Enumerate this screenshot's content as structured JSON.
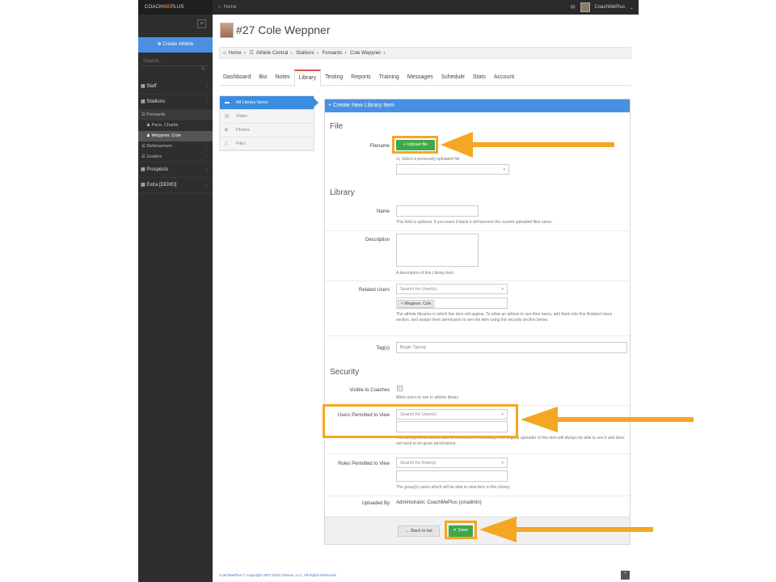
{
  "app": {
    "brand_pre": "COACH",
    "brand_me": "ME",
    "brand_post": "PLUS",
    "home": "Home",
    "user": "CoachMePlus",
    "user_chevron": "⌄"
  },
  "sidebar": {
    "create": "Create Athlete",
    "search": "Search...",
    "items": [
      {
        "label": "Staff",
        "chev": "‹"
      },
      {
        "label": "Stallions",
        "chev": "‹"
      }
    ],
    "sub": [
      {
        "label": "Forwards"
      },
      {
        "label": "Pace, Charlie"
      },
      {
        "label": "Weppner, Cole"
      },
      {
        "label": "Defensemen",
        "chev": "‹"
      },
      {
        "label": "Goalies",
        "chev": "‹"
      }
    ],
    "items2": [
      {
        "label": "Prospects",
        "chev": "‹"
      },
      {
        "label": "Extra [DEMO]",
        "chev": "‹"
      }
    ]
  },
  "athlete": {
    "title": "#27 Cole Weppner"
  },
  "breadcrumb": [
    "Home",
    "Athlete Central",
    "Stallions",
    "Forwards",
    "Cole Weppner"
  ],
  "tabs": [
    "Dashboard",
    "Bio",
    "Notes",
    "Library",
    "Testing",
    "Reports",
    "Training",
    "Messages",
    "Schedule",
    "Stats",
    "Account"
  ],
  "library_nav": [
    "All Library Items",
    "Video",
    "Photos",
    "Files"
  ],
  "form": {
    "header": "+ Create New Library Item",
    "file_section": "File",
    "filename_label": "Filename",
    "upload_btn": "+ Upload file",
    "prev_file_hint": "or, Select a previously uploaded file",
    "library_section": "Library",
    "name_label": "Name",
    "name_hint": "This field is optional. If you leave it blank it will become the current uploaded files name.",
    "desc_label": "Description",
    "desc_hint": "A description of this Library item.",
    "related_label": "Related Users",
    "related_placeholder": "Search for User(s)",
    "related_chip": "× Weppner, Cole",
    "related_hint": "The athlete libraries in which this item will appear. To allow an athlete to see their items, add them into this Related Users section, and assign them permission to see the item using the security section below.",
    "tags_label": "Tag(s)",
    "tags_placeholder": "Begin Typing",
    "security_section": "Security",
    "visible_label": "Visible to Coaches",
    "visible_hint": "Allow users to see in athlete library",
    "users_perm_label": "Users Permitted to View",
    "users_perm_placeholder": "Search for User(s)",
    "users_perm_hint": "The user(s) which will be able to view item in the Library. The original uploader of this item will always be able to see it and does not need to be given permissions.",
    "roles_perm_label": "Roles Permitted to View",
    "roles_perm_placeholder": "Search for Role(s)",
    "roles_perm_hint": "The group(s) users which will be able to view item in the Library.",
    "uploaded_by_label": "Uploaded By",
    "uploaded_by_value": "Administrator, CoachMePlus (cmadmin)",
    "back_btn": "← Back to list",
    "save_btn": "✔ Save"
  },
  "footer": {
    "copyright": "CoachMePlus © Copyright 2007-2018 Virtuvia, LLC. All Rights Reserved."
  },
  "colors": {
    "highlight": "#f5a623",
    "accent": "#4a90e2",
    "save": "#3ea94a"
  }
}
